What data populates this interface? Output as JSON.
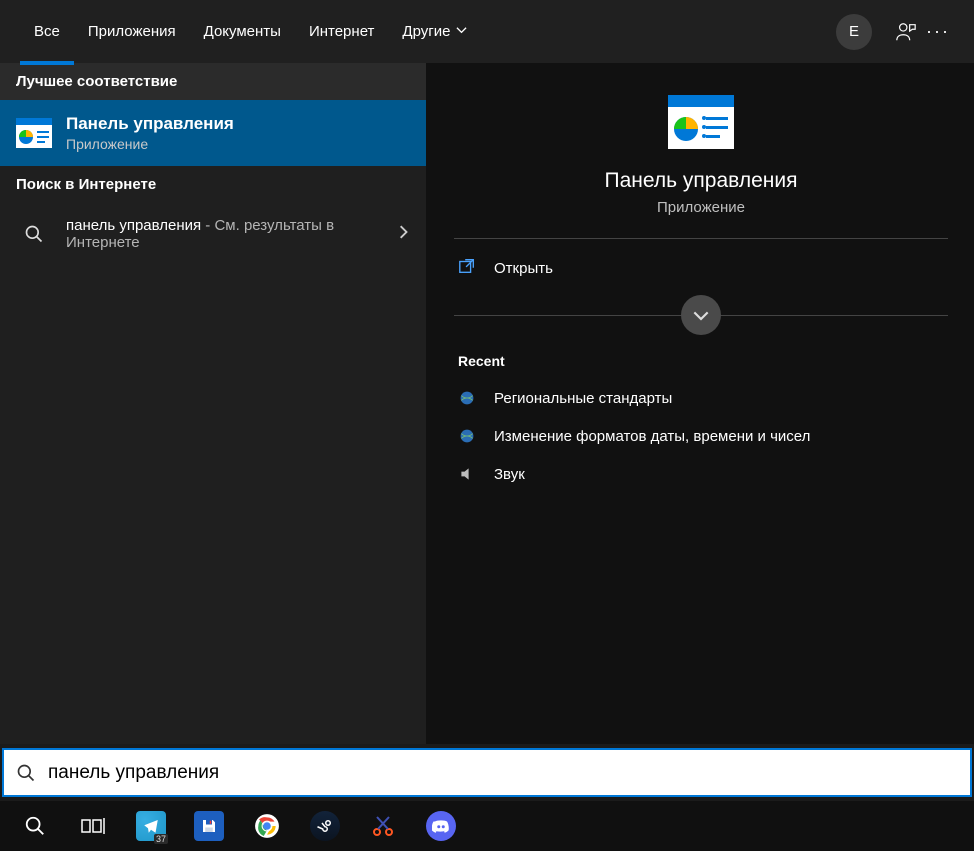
{
  "tabs": {
    "items": [
      "Все",
      "Приложения",
      "Документы",
      "Интернет",
      "Другие"
    ],
    "active_index": 0
  },
  "user_initial": "E",
  "left": {
    "best_match_header": "Лучшее соответствие",
    "best_match": {
      "title": "Панель управления",
      "subtitle": "Приложение"
    },
    "web_header": "Поиск в Интернете",
    "web_result": {
      "query": "панель управления",
      "tail": " - См. результаты в Интернете"
    }
  },
  "preview": {
    "title": "Панель управления",
    "subtitle": "Приложение",
    "open_label": "Открыть",
    "recent_header": "Recent",
    "recent": [
      "Региональные стандарты",
      "Изменение форматов даты, времени и чисел",
      "Звук"
    ]
  },
  "searchbox": {
    "value": "панель управления"
  },
  "taskbar": {
    "telegram_badge": "37"
  }
}
